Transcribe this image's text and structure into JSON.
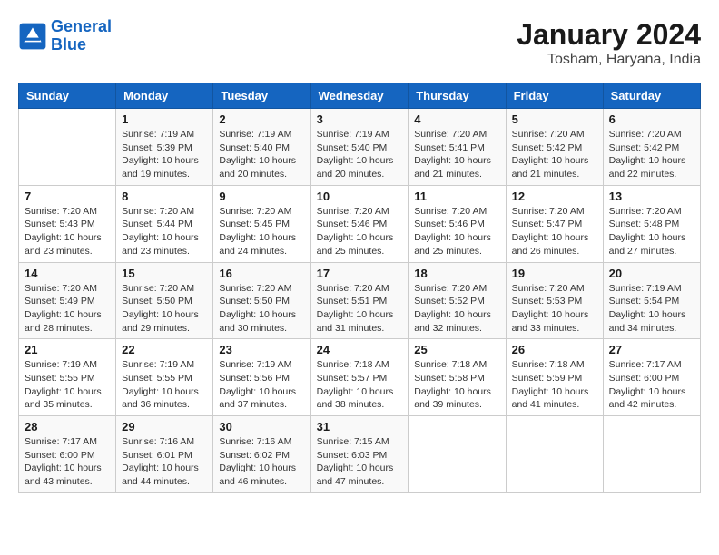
{
  "header": {
    "logo_line1": "General",
    "logo_line2": "Blue",
    "month_title": "January 2024",
    "location": "Tosham, Haryana, India"
  },
  "weekdays": [
    "Sunday",
    "Monday",
    "Tuesday",
    "Wednesday",
    "Thursday",
    "Friday",
    "Saturday"
  ],
  "weeks": [
    [
      {
        "day": "",
        "sunrise": "",
        "sunset": "",
        "daylight": ""
      },
      {
        "day": "1",
        "sunrise": "Sunrise: 7:19 AM",
        "sunset": "Sunset: 5:39 PM",
        "daylight": "Daylight: 10 hours and 19 minutes."
      },
      {
        "day": "2",
        "sunrise": "Sunrise: 7:19 AM",
        "sunset": "Sunset: 5:40 PM",
        "daylight": "Daylight: 10 hours and 20 minutes."
      },
      {
        "day": "3",
        "sunrise": "Sunrise: 7:19 AM",
        "sunset": "Sunset: 5:40 PM",
        "daylight": "Daylight: 10 hours and 20 minutes."
      },
      {
        "day": "4",
        "sunrise": "Sunrise: 7:20 AM",
        "sunset": "Sunset: 5:41 PM",
        "daylight": "Daylight: 10 hours and 21 minutes."
      },
      {
        "day": "5",
        "sunrise": "Sunrise: 7:20 AM",
        "sunset": "Sunset: 5:42 PM",
        "daylight": "Daylight: 10 hours and 21 minutes."
      },
      {
        "day": "6",
        "sunrise": "Sunrise: 7:20 AM",
        "sunset": "Sunset: 5:42 PM",
        "daylight": "Daylight: 10 hours and 22 minutes."
      }
    ],
    [
      {
        "day": "7",
        "sunrise": "Sunrise: 7:20 AM",
        "sunset": "Sunset: 5:43 PM",
        "daylight": "Daylight: 10 hours and 23 minutes."
      },
      {
        "day": "8",
        "sunrise": "Sunrise: 7:20 AM",
        "sunset": "Sunset: 5:44 PM",
        "daylight": "Daylight: 10 hours and 23 minutes."
      },
      {
        "day": "9",
        "sunrise": "Sunrise: 7:20 AM",
        "sunset": "Sunset: 5:45 PM",
        "daylight": "Daylight: 10 hours and 24 minutes."
      },
      {
        "day": "10",
        "sunrise": "Sunrise: 7:20 AM",
        "sunset": "Sunset: 5:46 PM",
        "daylight": "Daylight: 10 hours and 25 minutes."
      },
      {
        "day": "11",
        "sunrise": "Sunrise: 7:20 AM",
        "sunset": "Sunset: 5:46 PM",
        "daylight": "Daylight: 10 hours and 25 minutes."
      },
      {
        "day": "12",
        "sunrise": "Sunrise: 7:20 AM",
        "sunset": "Sunset: 5:47 PM",
        "daylight": "Daylight: 10 hours and 26 minutes."
      },
      {
        "day": "13",
        "sunrise": "Sunrise: 7:20 AM",
        "sunset": "Sunset: 5:48 PM",
        "daylight": "Daylight: 10 hours and 27 minutes."
      }
    ],
    [
      {
        "day": "14",
        "sunrise": "Sunrise: 7:20 AM",
        "sunset": "Sunset: 5:49 PM",
        "daylight": "Daylight: 10 hours and 28 minutes."
      },
      {
        "day": "15",
        "sunrise": "Sunrise: 7:20 AM",
        "sunset": "Sunset: 5:50 PM",
        "daylight": "Daylight: 10 hours and 29 minutes."
      },
      {
        "day": "16",
        "sunrise": "Sunrise: 7:20 AM",
        "sunset": "Sunset: 5:50 PM",
        "daylight": "Daylight: 10 hours and 30 minutes."
      },
      {
        "day": "17",
        "sunrise": "Sunrise: 7:20 AM",
        "sunset": "Sunset: 5:51 PM",
        "daylight": "Daylight: 10 hours and 31 minutes."
      },
      {
        "day": "18",
        "sunrise": "Sunrise: 7:20 AM",
        "sunset": "Sunset: 5:52 PM",
        "daylight": "Daylight: 10 hours and 32 minutes."
      },
      {
        "day": "19",
        "sunrise": "Sunrise: 7:20 AM",
        "sunset": "Sunset: 5:53 PM",
        "daylight": "Daylight: 10 hours and 33 minutes."
      },
      {
        "day": "20",
        "sunrise": "Sunrise: 7:19 AM",
        "sunset": "Sunset: 5:54 PM",
        "daylight": "Daylight: 10 hours and 34 minutes."
      }
    ],
    [
      {
        "day": "21",
        "sunrise": "Sunrise: 7:19 AM",
        "sunset": "Sunset: 5:55 PM",
        "daylight": "Daylight: 10 hours and 35 minutes."
      },
      {
        "day": "22",
        "sunrise": "Sunrise: 7:19 AM",
        "sunset": "Sunset: 5:55 PM",
        "daylight": "Daylight: 10 hours and 36 minutes."
      },
      {
        "day": "23",
        "sunrise": "Sunrise: 7:19 AM",
        "sunset": "Sunset: 5:56 PM",
        "daylight": "Daylight: 10 hours and 37 minutes."
      },
      {
        "day": "24",
        "sunrise": "Sunrise: 7:18 AM",
        "sunset": "Sunset: 5:57 PM",
        "daylight": "Daylight: 10 hours and 38 minutes."
      },
      {
        "day": "25",
        "sunrise": "Sunrise: 7:18 AM",
        "sunset": "Sunset: 5:58 PM",
        "daylight": "Daylight: 10 hours and 39 minutes."
      },
      {
        "day": "26",
        "sunrise": "Sunrise: 7:18 AM",
        "sunset": "Sunset: 5:59 PM",
        "daylight": "Daylight: 10 hours and 41 minutes."
      },
      {
        "day": "27",
        "sunrise": "Sunrise: 7:17 AM",
        "sunset": "Sunset: 6:00 PM",
        "daylight": "Daylight: 10 hours and 42 minutes."
      }
    ],
    [
      {
        "day": "28",
        "sunrise": "Sunrise: 7:17 AM",
        "sunset": "Sunset: 6:00 PM",
        "daylight": "Daylight: 10 hours and 43 minutes."
      },
      {
        "day": "29",
        "sunrise": "Sunrise: 7:16 AM",
        "sunset": "Sunset: 6:01 PM",
        "daylight": "Daylight: 10 hours and 44 minutes."
      },
      {
        "day": "30",
        "sunrise": "Sunrise: 7:16 AM",
        "sunset": "Sunset: 6:02 PM",
        "daylight": "Daylight: 10 hours and 46 minutes."
      },
      {
        "day": "31",
        "sunrise": "Sunrise: 7:15 AM",
        "sunset": "Sunset: 6:03 PM",
        "daylight": "Daylight: 10 hours and 47 minutes."
      },
      {
        "day": "",
        "sunrise": "",
        "sunset": "",
        "daylight": ""
      },
      {
        "day": "",
        "sunrise": "",
        "sunset": "",
        "daylight": ""
      },
      {
        "day": "",
        "sunrise": "",
        "sunset": "",
        "daylight": ""
      }
    ]
  ]
}
